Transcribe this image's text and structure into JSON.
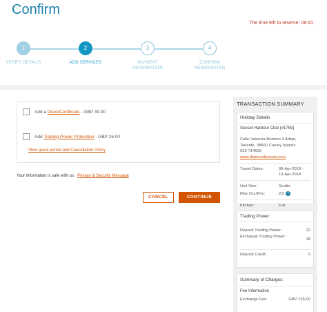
{
  "page": {
    "title": "Confirm",
    "timer_label": "The time left to reserve:",
    "timer_value": "08:41"
  },
  "steps": [
    {
      "num": "1",
      "label": "VERIFY DETAILS",
      "label2": ""
    },
    {
      "num": "2",
      "label": "ADD SERVICES",
      "label2": ""
    },
    {
      "num": "3",
      "label": "PAYMENT",
      "label2": "INFORMATION"
    },
    {
      "num": "4",
      "label": "CONFIRM",
      "label2": "RESERVATION"
    }
  ],
  "addons": {
    "guest": {
      "prefix": "Add a",
      "link": "GuestCertificate",
      "price": "- GBP 39.00"
    },
    "tpp": {
      "prefix": "Add",
      "link": "Trading Power Protection",
      "price": "- GBP 26.00"
    },
    "grace_link": "View grace period and Cancellation Policy"
  },
  "safe": {
    "text": "Your information is safe with us.",
    "link": "Privacy & Security Message"
  },
  "buttons": {
    "cancel": "CANCEL",
    "continue": "CONTINUE"
  },
  "summary": {
    "title": "TRANSACTION SUMMARY",
    "holiday": {
      "title": "Holiday Details",
      "resort": "Sunset Harbour Club (#1759)",
      "address1": "Calle Valencia Número 3 Adeje,",
      "address2": "Tenerife, 38660 Canary Islands",
      "phone": "922-714630",
      "website": "www.diamondresorts.com",
      "travel_label": "Travel Dates:",
      "travel_value1": "06-Apr-2018 -",
      "travel_value2": "13-Apr-2018",
      "unit_label": "Unit Size:",
      "unit_value": "Studio",
      "occ_label": "Max Occ/Priv:",
      "occ_value": "2/2",
      "info_glyph": "i",
      "kitchen_label": "Kitchen:",
      "kitchen_value": "Full"
    },
    "trading": {
      "title": "Trading Power:",
      "deposit_label": "Deposit Trading Power:",
      "deposit_value": "22",
      "exchange_label": "Exchange Trading Power:",
      "exchange_value": "18",
      "credit_label": "Deposit Credit:",
      "credit_value": "0"
    },
    "charges": {
      "title": "Summary of Charges:",
      "fee_title": "Fee Information",
      "fee_label": "Exchange Fee:",
      "fee_value": "GBP 155.00"
    }
  }
}
